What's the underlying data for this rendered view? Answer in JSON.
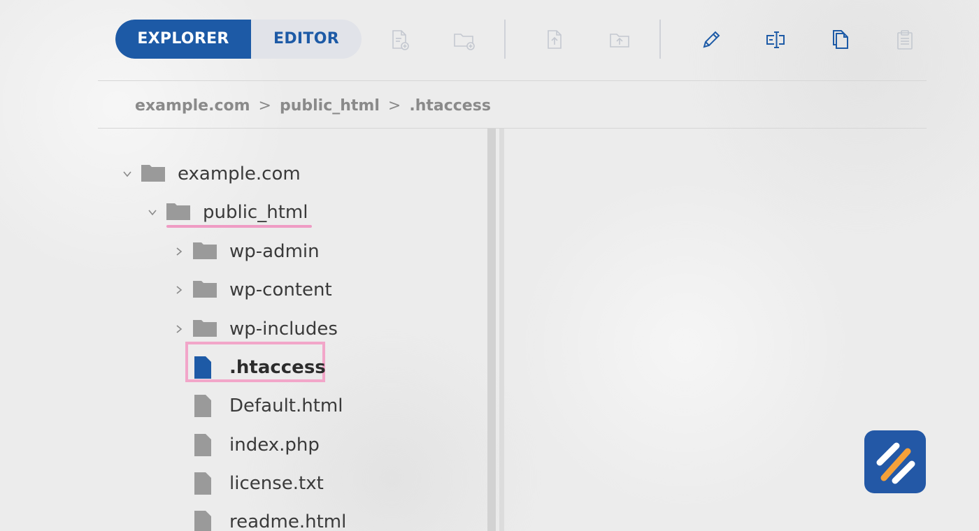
{
  "tabs": {
    "explorer": "EXPLORER",
    "editor": "EDITOR",
    "active": "explorer"
  },
  "toolbar": {
    "icons": [
      "new-file-icon",
      "new-folder-icon",
      "upload-file-icon",
      "upload-folder-icon",
      "rename-icon",
      "rename-field-icon",
      "copy-icon",
      "paste-icon"
    ],
    "disabled": [
      "new-file-icon",
      "new-folder-icon",
      "upload-file-icon",
      "upload-folder-icon",
      "paste-icon"
    ]
  },
  "breadcrumb": {
    "items": [
      "example.com",
      "public_html",
      ".htaccess"
    ],
    "separator": ">"
  },
  "tree": {
    "root": "example.com",
    "public_html": "public_html",
    "folders": [
      "wp-admin",
      "wp-content",
      "wp-includes"
    ],
    "files": [
      ".htaccess",
      "Default.html",
      "index.php",
      "license.txt",
      "readme.html"
    ],
    "selected": ".htaccess"
  },
  "colors": {
    "accent": "#1d5aa6",
    "highlight": "#f2a6c9",
    "folder": "#9a9a9a",
    "logo_bg": "#2358a6",
    "logo_orange": "#f5a13a"
  }
}
